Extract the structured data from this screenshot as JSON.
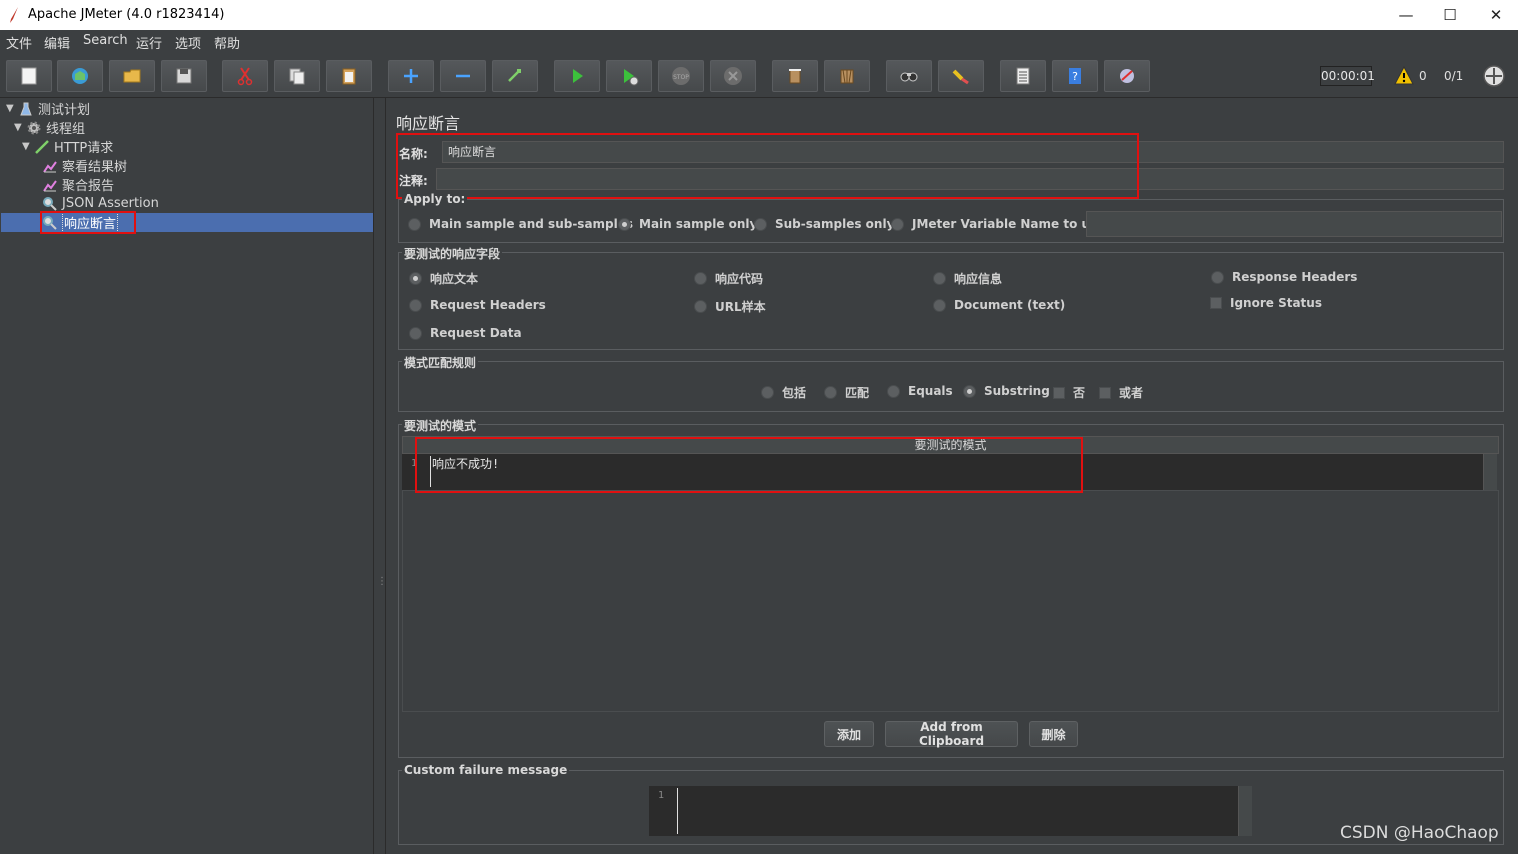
{
  "window": {
    "title": "Apache JMeter (4.0 r1823414)",
    "min_icon": "minimize-icon",
    "max_icon": "maximize-icon",
    "close_icon": "close-icon",
    "min_glyph": "—",
    "max_glyph": "☐",
    "close_glyph": "✕"
  },
  "menu": [
    "文件",
    "编辑",
    "Search",
    "运行",
    "选项",
    "帮助"
  ],
  "toolbar": {
    "buttons": [
      "new-icon",
      "templates-icon",
      "open-icon",
      "save-icon",
      "cut-icon",
      "copy-icon",
      "paste-icon",
      "expand-icon",
      "collapse-icon",
      "toggle-icon",
      "start-icon",
      "start-no-timers-icon",
      "stop-icon",
      "shutdown-icon",
      "clear-icon",
      "clear-all-icon",
      "search-icon",
      "reset-search-icon",
      "function-helper-icon",
      "help-icon",
      "remote-icon"
    ],
    "timer": "00:00:01",
    "warnings": "0",
    "threads": "0/1"
  },
  "tree": {
    "items": [
      {
        "label": "测试计划",
        "icon": "test-plan-icon"
      },
      {
        "label": "线程组",
        "icon": "thread-group-icon"
      },
      {
        "label": "HTTP请求",
        "icon": "http-sampler-icon"
      },
      {
        "label": "察看结果树",
        "icon": "listener-icon"
      },
      {
        "label": "聚合报告",
        "icon": "listener-icon"
      },
      {
        "label": "JSON Assertion",
        "icon": "assertion-icon"
      },
      {
        "label": "响应断言",
        "icon": "assertion-icon"
      }
    ]
  },
  "panel": {
    "title": "响应断言",
    "name_label": "名称:",
    "name_value": "响应断言",
    "comment_label": "注释:",
    "comment_value": "",
    "apply_to": {
      "title": "Apply to:",
      "options": [
        "Main sample and sub-samples",
        "Main sample only",
        "Sub-samples only",
        "JMeter Variable Name to use"
      ],
      "selected": "Main sample only",
      "variable_value": ""
    },
    "field_to_test": {
      "title": "要测试的响应字段",
      "options": [
        "响应文本",
        "响应代码",
        "响应信息",
        "Response Headers",
        "Request Headers",
        "URL样本",
        "Document (text)",
        "Ignore Status",
        "Request Data"
      ],
      "selected": "响应文本"
    },
    "pattern_matching": {
      "title": "模式匹配规则",
      "options": [
        "包括",
        "匹配",
        "Equals",
        "Substring",
        "否",
        "或者"
      ],
      "selected": "Substring"
    },
    "patterns": {
      "title": "要测试的模式",
      "column_header": "要测试的模式",
      "line_number": "1",
      "rows": [
        "响应不成功!"
      ],
      "add_button": "添加",
      "clipboard_button": "Add from Clipboard",
      "delete_button": "删除"
    },
    "custom_failure": {
      "title": "Custom failure message",
      "line_number": "1",
      "value": ""
    }
  },
  "watermark": "CSDN @HaoChaop",
  "colors": {
    "selection": "#4b6eaf",
    "highlight_box": "#e01010",
    "background": "#3c3f41"
  }
}
